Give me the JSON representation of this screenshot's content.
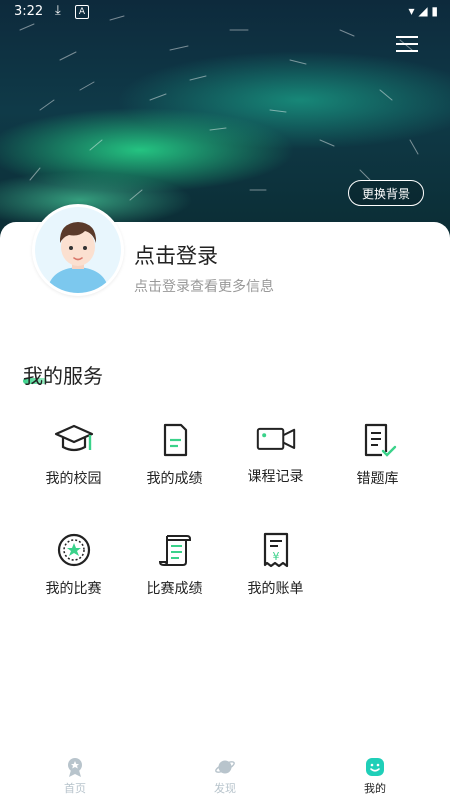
{
  "status_bar": {
    "time": "3:22",
    "a_icon": "A"
  },
  "header": {
    "change_bg_label": "更换背景"
  },
  "profile": {
    "login_title": "点击登录",
    "login_subtitle": "点击登录查看更多信息"
  },
  "services": {
    "title": "我的服务",
    "items": [
      {
        "label": "我的校园",
        "icon": "graduation-cap-icon"
      },
      {
        "label": "我的成绩",
        "icon": "document-icon"
      },
      {
        "label": "课程记录",
        "icon": "video-camera-icon"
      },
      {
        "label": "错题库",
        "icon": "checklist-icon"
      },
      {
        "label": "我的比赛",
        "icon": "medal-icon"
      },
      {
        "label": "比赛成绩",
        "icon": "scroll-icon"
      },
      {
        "label": "我的账单",
        "icon": "receipt-icon"
      }
    ]
  },
  "tabbar": {
    "items": [
      {
        "label": "首页",
        "icon": "home-badge-icon",
        "active": false
      },
      {
        "label": "发现",
        "icon": "planet-icon",
        "active": false
      },
      {
        "label": "我的",
        "icon": "smile-icon",
        "active": true
      }
    ]
  },
  "colors": {
    "accent": "#3ad28a",
    "tab_active": "#1fcfb8",
    "tab_inactive": "#b8c4cc"
  }
}
